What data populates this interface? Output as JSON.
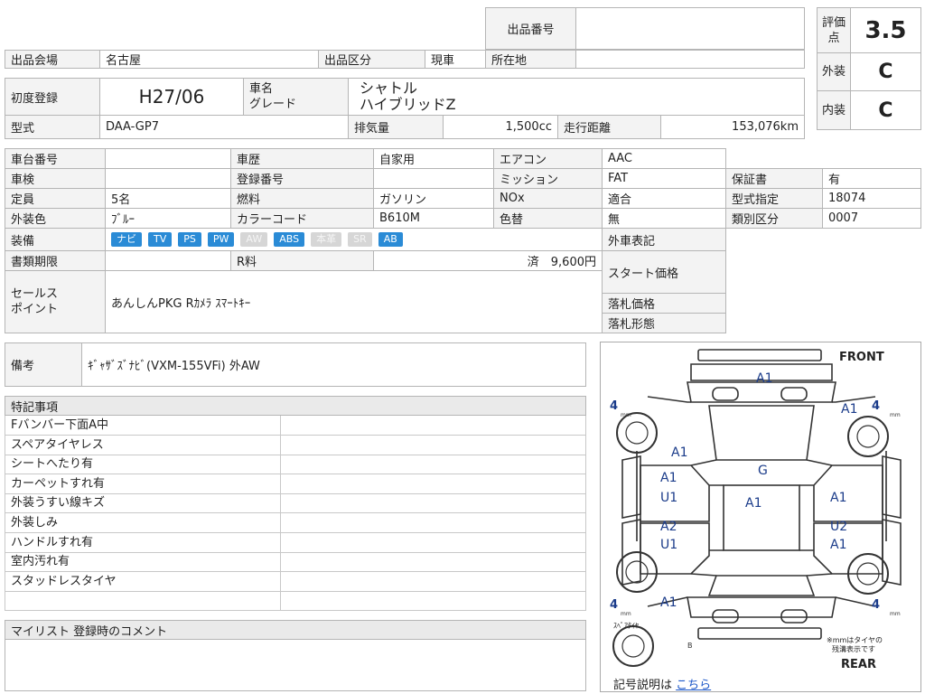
{
  "header": {
    "lot_number_label": "出品番号",
    "lot_number_value": "",
    "venue_label": "出品会場",
    "venue_value": "名古屋",
    "category_label": "出品区分",
    "category_value": "現車",
    "location_label": "所在地",
    "location_value": ""
  },
  "grades": {
    "score_label": "評価点",
    "score_value": "3.5",
    "exterior_label": "外装",
    "exterior_value": "C",
    "interior_label": "内装",
    "interior_value": "C"
  },
  "car": {
    "first_reg_label": "初度登録",
    "first_reg_value": "H27/06",
    "name_label": "車名",
    "grade_label": "グレード",
    "name_value": "シャトル",
    "grade_value": "ハイブリッドZ",
    "model_label": "型式",
    "model_value": "DAA-GP7",
    "displacement_label": "排気量",
    "displacement_value": "1,500cc",
    "mileage_label": "走行距離",
    "mileage_value": "153,076km"
  },
  "details": {
    "chassis_label": "車台番号",
    "chassis_value": "",
    "history_label": "車歴",
    "history_value": "自家用",
    "ac_label": "エアコン",
    "ac_value": "AAC",
    "inspection_label": "車検",
    "inspection_value": "",
    "regno_label": "登録番号",
    "regno_value": "",
    "mission_label": "ミッション",
    "mission_value": "FAT",
    "warranty_label": "保証書",
    "warranty_value": "有",
    "capacity_label": "定員",
    "capacity_value": "5名",
    "fuel_label": "燃料",
    "fuel_value": "ガソリン",
    "nox_label": "NOx",
    "nox_value": "適合",
    "type_designation_label": "型式指定",
    "type_designation_value": "18074",
    "color_label": "外装色",
    "color_value": "ﾌﾞﾙｰ",
    "color_code_label": "カラーコード",
    "color_code_value": "B610M",
    "color_change_label": "色替",
    "color_change_value": "無",
    "class_label": "類別区分",
    "class_value": "0007",
    "equipment_label": "装備",
    "equipment": [
      {
        "name": "ナビ",
        "on": true
      },
      {
        "name": "TV",
        "on": true
      },
      {
        "name": "PS",
        "on": true
      },
      {
        "name": "PW",
        "on": true
      },
      {
        "name": "AW",
        "on": false
      },
      {
        "name": "ABS",
        "on": true
      },
      {
        "name": "本革",
        "on": false
      },
      {
        "name": "SR",
        "on": false
      },
      {
        "name": "AB",
        "on": true
      }
    ],
    "outside_label": "外車表記",
    "docs_label": "書類期限",
    "docs_value": "",
    "recycle_label": "R料",
    "recycle_value": "済　9,600円",
    "start_price_label": "スタート価格",
    "sales_label": "セールス\nポイント",
    "sales_value": "あんしんPKG Rｶﾒﾗ ｽﾏｰﾄｷｰ",
    "winning_price_label": "落札価格",
    "winning_form_label": "落札形態"
  },
  "notes": {
    "label": "備考",
    "value": "ｷﾞｬｻﾞｽﾞﾅﾋﾞ(VXM-155VFi) 外AW"
  },
  "special": {
    "title": "特記事項",
    "items": [
      "Fバンバー下面A中",
      "スペアタイヤレス",
      "シートへたり有",
      "カーペットすれ有",
      "外装うすい線キズ",
      "外装しみ",
      "ハンドルすれ有",
      "室内汚れ有",
      "スタッドレスタイヤ",
      ""
    ]
  },
  "mylist": {
    "title": "マイリスト 登録時のコメント"
  },
  "diagram": {
    "front_label": "FRONT",
    "rear_label": "REAR",
    "spare_label": "ｽﾍﾟｱﾀｲﾔ",
    "note_label": "※mmはタイヤの\n残溝表示です",
    "legend_label": "記号説明は",
    "legend_link": "こちら",
    "tire_small": "mm",
    "tire_depths": [
      "4",
      "4",
      "4",
      "4"
    ],
    "marks": {
      "front_bumper": "A1",
      "hood": "G",
      "left_front_fender": "A1",
      "right_front_fender_top": "A1",
      "left_front_door_1": "A1",
      "left_front_door_2": "U1",
      "roof": "A1",
      "right_front_door": "A1",
      "left_rear_door_1": "A2",
      "left_rear_door_2": "U1",
      "right_rear_door_1": "U2",
      "right_rear_door_2": "A1",
      "left_rear_quarter": "A1"
    }
  }
}
